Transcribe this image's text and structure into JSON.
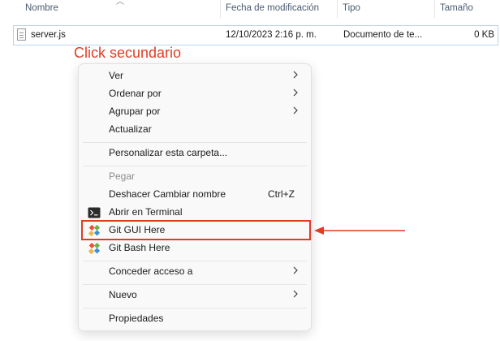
{
  "header": {
    "columns": [
      {
        "label": "Nombre"
      },
      {
        "label": "Fecha de modificación"
      },
      {
        "label": "Tipo"
      },
      {
        "label": "Tamaño"
      }
    ]
  },
  "file": {
    "name": "server.js",
    "modified": "12/10/2023 2:16 p. m.",
    "type": "Documento de te...",
    "size": "0 KB"
  },
  "annotation": {
    "title": "Click secundario",
    "color": "#e03c24"
  },
  "menu": {
    "items": [
      {
        "label": "Ver",
        "submenu": true
      },
      {
        "label": "Ordenar por",
        "submenu": true
      },
      {
        "label": "Agrupar por",
        "submenu": true
      },
      {
        "label": "Actualizar"
      },
      {
        "label": "Personalizar esta carpeta..."
      },
      {
        "label": "Pegar",
        "disabled": true
      },
      {
        "label": "Deshacer Cambiar nombre",
        "shortcut": "Ctrl+Z"
      },
      {
        "label": "Abrir en Terminal",
        "icon": "terminal-icon"
      },
      {
        "label": "Git GUI Here",
        "icon": "git-icon",
        "highlighted": true
      },
      {
        "label": "Git Bash Here",
        "icon": "git-icon"
      },
      {
        "label": "Conceder acceso a",
        "submenu": true
      },
      {
        "label": "Nuevo",
        "submenu": true
      },
      {
        "label": "Propiedades"
      }
    ]
  }
}
